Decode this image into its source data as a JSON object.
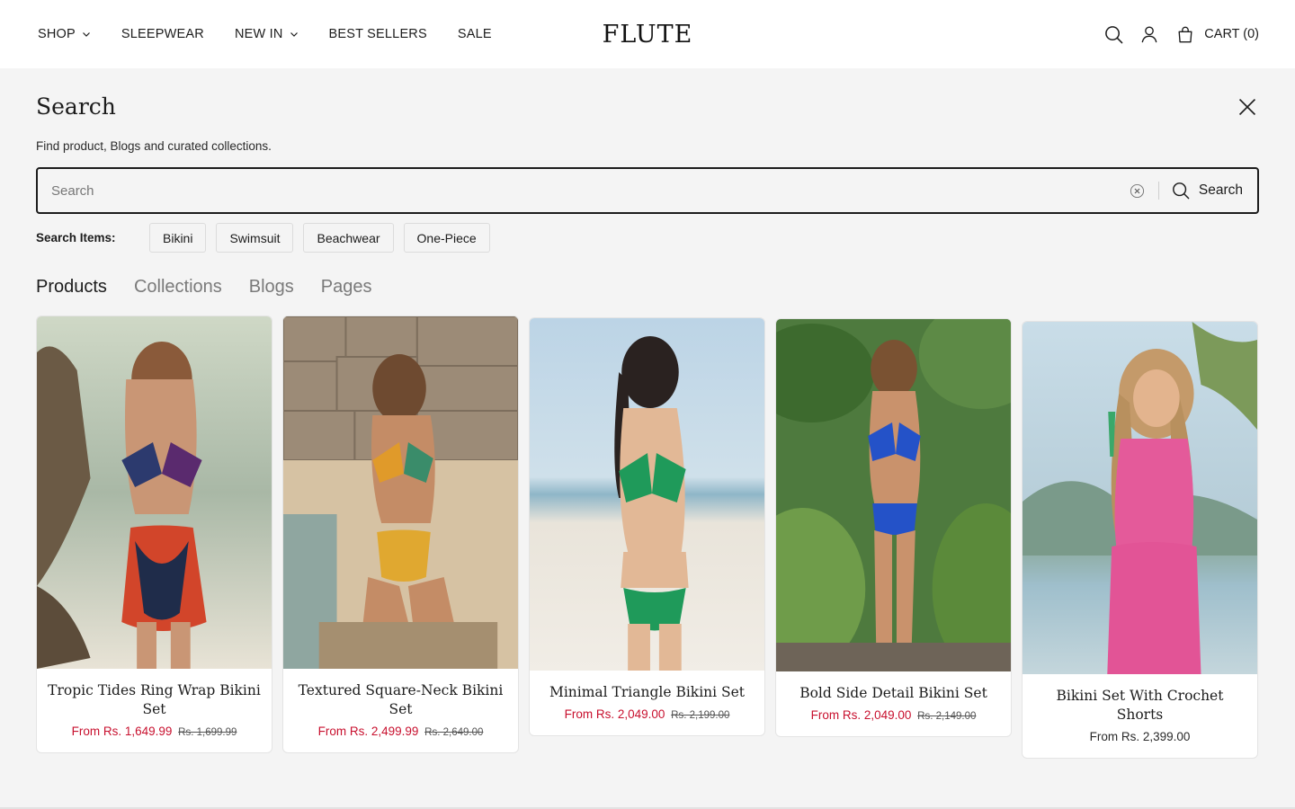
{
  "header": {
    "nav": [
      {
        "label": "SHOP",
        "has_dropdown": true
      },
      {
        "label": "SLEEPWEAR",
        "has_dropdown": false
      },
      {
        "label": "NEW IN",
        "has_dropdown": true
      },
      {
        "label": "BEST SELLERS",
        "has_dropdown": false
      },
      {
        "label": "SALE",
        "has_dropdown": false
      }
    ],
    "logo": "FLUTE",
    "icons": [
      "search-icon",
      "account-icon",
      "cart-bag-icon"
    ],
    "cart_label": "CART (0)"
  },
  "search_panel": {
    "title": "Search",
    "subtitle": "Find product, Blogs and curated collections.",
    "input_placeholder": "Search",
    "input_value": "",
    "submit_label": "Search",
    "chips_label": "Search Items:",
    "chips": [
      "Bikini",
      "Swimsuit",
      "Beachwear",
      "One-Piece"
    ],
    "tabs": [
      {
        "label": "Products",
        "active": true
      },
      {
        "label": "Collections",
        "active": false
      },
      {
        "label": "Blogs",
        "active": false
      },
      {
        "label": "Pages",
        "active": false
      }
    ]
  },
  "products": [
    {
      "name": "Tropic Tides Ring Wrap Bikini Set",
      "price": "From Rs. 1,649.99",
      "compare_price": "Rs. 1,699.99",
      "on_sale": true
    },
    {
      "name": "Textured Square-Neck Bikini Set",
      "price": "From Rs. 2,499.99",
      "compare_price": "Rs. 2,649.00",
      "on_sale": true
    },
    {
      "name": "Minimal Triangle Bikini Set",
      "price": "From Rs. 2,049.00",
      "compare_price": "Rs. 2,199.00",
      "on_sale": true
    },
    {
      "name": "Bold Side Detail Bikini Set",
      "price": "From Rs. 2,049.00",
      "compare_price": "Rs. 2,149.00",
      "on_sale": true
    },
    {
      "name": "Bikini Set With Crochet Shorts",
      "price": "From Rs. 2,399.00",
      "compare_price": "",
      "on_sale": false
    }
  ],
  "colors": {
    "panel_bg": "#f4f4f4",
    "sale_red": "#c8102e",
    "text": "#1c1c1c"
  }
}
